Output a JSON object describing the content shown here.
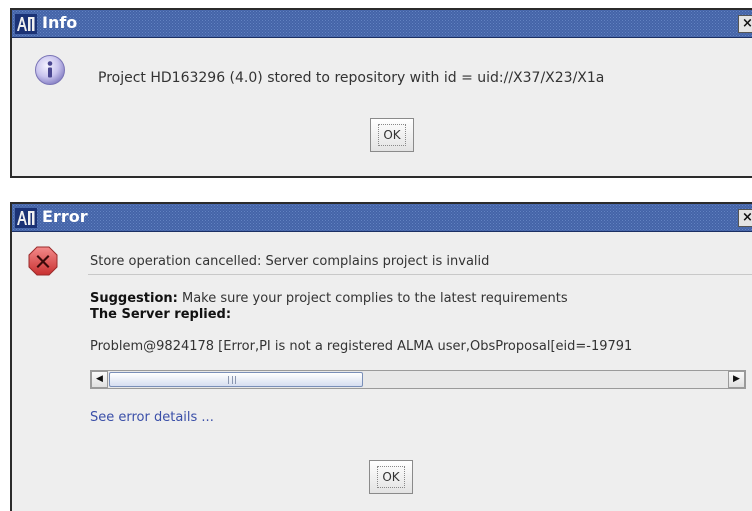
{
  "info_dialog": {
    "title": "Info",
    "icon": "info-icon",
    "message": "Project HD163296 (4.0) stored to repository with id = uid://X37/X23/X1a",
    "ok_label": "OK",
    "close_glyph": "×"
  },
  "error_dialog": {
    "title": "Error",
    "icon": "error-x-icon",
    "message": "Store operation cancelled: Server complains project is invalid",
    "suggestion_label": "Suggestion:",
    "suggestion_text": " Make sure your project complies to the latest requirements",
    "server_replied": "The Server replied:",
    "problem": "Problem@9824178 [Error,PI is not a registered ALMA user,ObsProposal[eid=-19791",
    "scroll_left": "◀",
    "scroll_right": "▶",
    "details_link": "See error details ...",
    "ok_label": "OK",
    "close_glyph": "×"
  },
  "colors": {
    "titlebar": "#25458e",
    "dialog_bg": "#eeeeee",
    "link": "#3a4fa8",
    "error_icon": "#d04040"
  }
}
